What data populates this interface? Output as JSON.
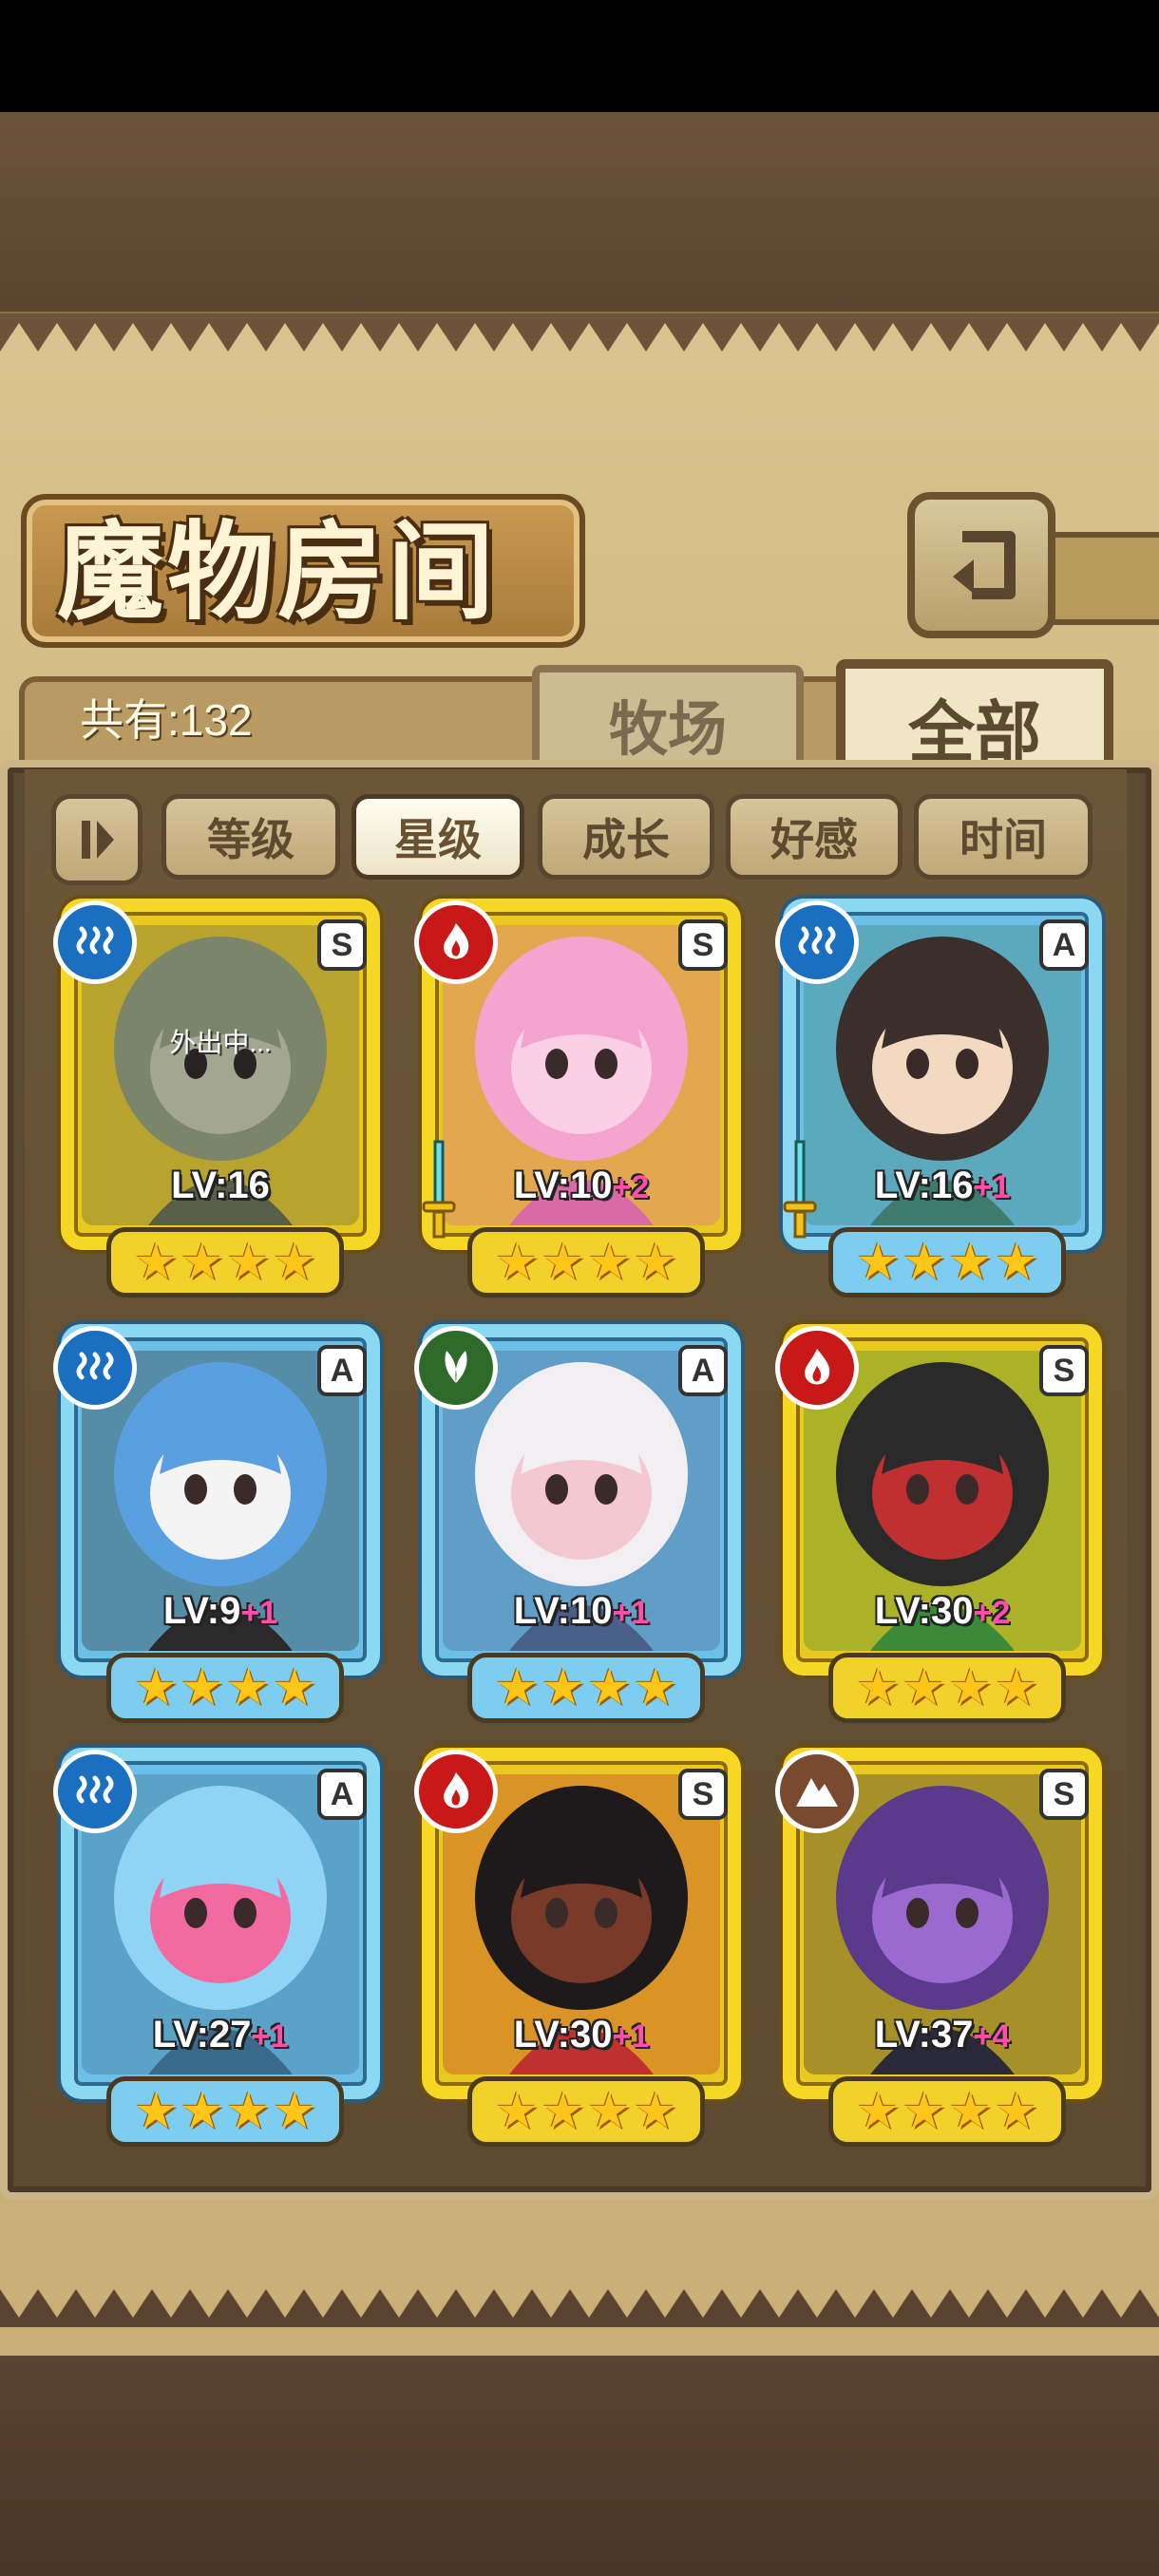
{
  "header": {
    "title": "魔物房间",
    "count_text": "共有:132",
    "tabs": [
      {
        "label": "牧场",
        "active": false
      },
      {
        "label": "全部",
        "active": true
      }
    ]
  },
  "sort": {
    "options": [
      {
        "label": "等级",
        "active": false
      },
      {
        "label": "星级",
        "active": true
      },
      {
        "label": "成长",
        "active": false
      },
      {
        "label": "好感",
        "active": false
      },
      {
        "label": "时间",
        "active": false
      }
    ]
  },
  "cards": [
    {
      "element": "water",
      "rank": "S",
      "frame": "gold",
      "level": "LV:16",
      "plus": "",
      "stars": 4,
      "status": "外出中...",
      "weapon": false,
      "palette": [
        "#8fae5a",
        "#c9d68a",
        "#6b7a36"
      ]
    },
    {
      "element": "fire",
      "rank": "S",
      "frame": "gold",
      "level": "LV:10",
      "plus": "+2",
      "stars": 4,
      "status": "",
      "weapon": true,
      "palette": [
        "#f5a3cf",
        "#fbd0e6",
        "#d96aa8"
      ]
    },
    {
      "element": "water",
      "rank": "A",
      "frame": "blue",
      "level": "LV:16",
      "plus": "+1",
      "stars": 4,
      "status": "",
      "weapon": true,
      "palette": [
        "#3a2f2a",
        "#f3d9c0",
        "#3f7a6e"
      ]
    },
    {
      "element": "water",
      "rank": "A",
      "frame": "blue",
      "level": "LV:9",
      "plus": "+1",
      "stars": 4,
      "status": "",
      "weapon": false,
      "palette": [
        "#5aa0e0",
        "#f4f4f4",
        "#2a2a2a"
      ]
    },
    {
      "element": "wind",
      "rank": "A",
      "frame": "blue",
      "level": "LV:10",
      "plus": "+1",
      "stars": 4,
      "status": "",
      "weapon": false,
      "palette": [
        "#f2eff2",
        "#f4c8d0",
        "#4a5e8a"
      ]
    },
    {
      "element": "fire",
      "rank": "S",
      "frame": "gold",
      "level": "LV:30",
      "plus": "+2",
      "stars": 4,
      "status": "",
      "weapon": false,
      "palette": [
        "#2a2a2a",
        "#c03030",
        "#3a8a3a"
      ]
    },
    {
      "element": "water",
      "rank": "A",
      "frame": "blue",
      "level": "LV:27",
      "plus": "+1",
      "stars": 4,
      "status": "",
      "weapon": false,
      "palette": [
        "#8fd4f4",
        "#f26aa0",
        "#3a6a8a"
      ]
    },
    {
      "element": "fire",
      "rank": "S",
      "frame": "gold",
      "level": "LV:30",
      "plus": "+1",
      "stars": 4,
      "status": "",
      "weapon": false,
      "palette": [
        "#1e1a1c",
        "#7a3a2a",
        "#c03030"
      ]
    },
    {
      "element": "earth",
      "rank": "S",
      "frame": "gold",
      "level": "LV:37",
      "plus": "+4",
      "stars": 4,
      "status": "",
      "weapon": false,
      "palette": [
        "#5a3a8a",
        "#9a6ad0",
        "#2a2a3a"
      ]
    }
  ],
  "element_colors": {
    "water": "#1a6fc0",
    "fire": "#c81818",
    "wind": "#2e6a2a",
    "earth": "#7a4a30"
  }
}
